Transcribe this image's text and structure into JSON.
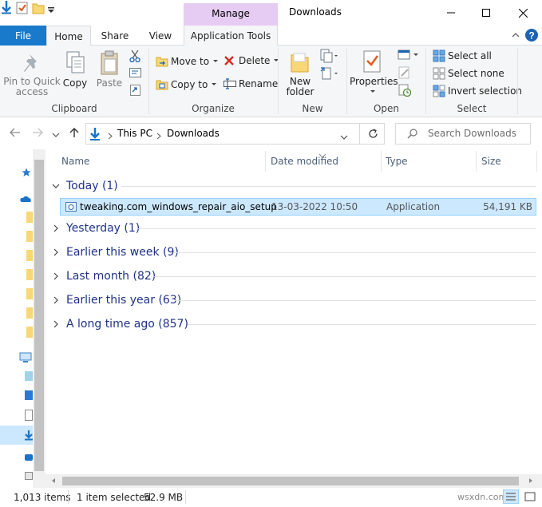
{
  "titlebar": {
    "context_tab": "Manage",
    "window_title": "Downloads"
  },
  "tabs": {
    "file": "File",
    "home": "Home",
    "share": "Share",
    "view": "View",
    "app_tools": "Application Tools"
  },
  "ribbon": {
    "clipboard": {
      "pin_line1": "Pin to Quick",
      "pin_line2": "access",
      "copy": "Copy",
      "paste": "Paste",
      "label": "Clipboard"
    },
    "organize": {
      "move_to": "Move to",
      "copy_to": "Copy to",
      "delete": "Delete",
      "rename": "Rename",
      "label": "Organize"
    },
    "new": {
      "new_folder_line1": "New",
      "new_folder_line2": "folder",
      "label": "New"
    },
    "open": {
      "properties": "Properties",
      "label": "Open"
    },
    "select": {
      "select_all": "Select all",
      "select_none": "Select none",
      "invert": "Invert selection",
      "label": "Select"
    }
  },
  "address": {
    "crumb1": "This PC",
    "crumb2": "Downloads",
    "search_placeholder": "Search Downloads"
  },
  "columns": {
    "name": "Name",
    "date": "Date modified",
    "type": "Type",
    "size": "Size"
  },
  "groups": [
    {
      "title": "Today (1)",
      "expanded": true
    },
    {
      "title": "Yesterday (1)",
      "expanded": false
    },
    {
      "title": "Earlier this week (9)",
      "expanded": false
    },
    {
      "title": "Last month (82)",
      "expanded": false
    },
    {
      "title": "Earlier this year (63)",
      "expanded": false
    },
    {
      "title": "A long time ago (857)",
      "expanded": false
    }
  ],
  "file": {
    "name": "tweaking.com_windows_repair_aio_setup",
    "date": "13-03-2022 10:50",
    "type": "Application",
    "size": "54,191 KB"
  },
  "status": {
    "items": "1,013 items",
    "selected": "1 item selected",
    "selected_size": "52.9 MB"
  },
  "watermark": "wsxdn.com",
  "colors": {
    "accent": "#1979ca",
    "context": "#e6ccf2",
    "selection": "#cce8ff",
    "group_text": "#1e3287"
  }
}
